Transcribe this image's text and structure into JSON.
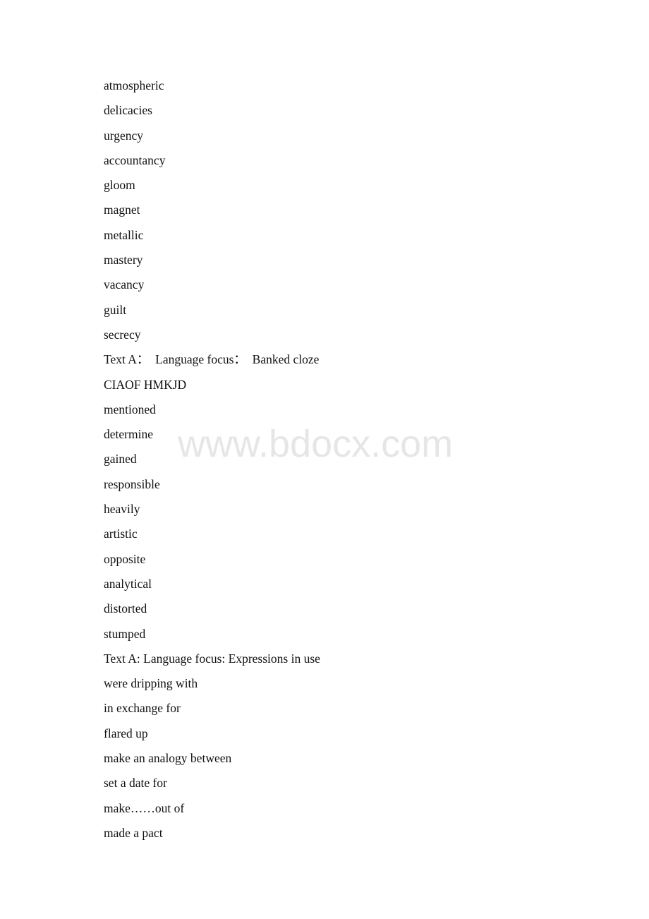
{
  "document": {
    "lines": [
      "atmospheric",
      "delicacies",
      "urgency",
      "accountancy",
      "gloom",
      "magnet",
      "metallic",
      "mastery",
      "vacancy",
      "guilt",
      "secrecy",
      "Text A：  Language focus：  Banked cloze",
      "CIAOF HMKJD",
      "mentioned",
      "determine",
      "gained",
      "responsible",
      "heavily",
      "artistic",
      "opposite",
      "analytical",
      "distorted",
      "stumped",
      "Text A: Language focus: Expressions in use",
      "were dripping with",
      "in exchange for",
      "flared up",
      "make an analogy between",
      "set a date for",
      "make……out of",
      "made a pact"
    ],
    "watermark": "www.bdocx.com"
  },
  "colors": {
    "text": "#111111",
    "watermark": "#e6e6e6",
    "background": "#ffffff"
  }
}
